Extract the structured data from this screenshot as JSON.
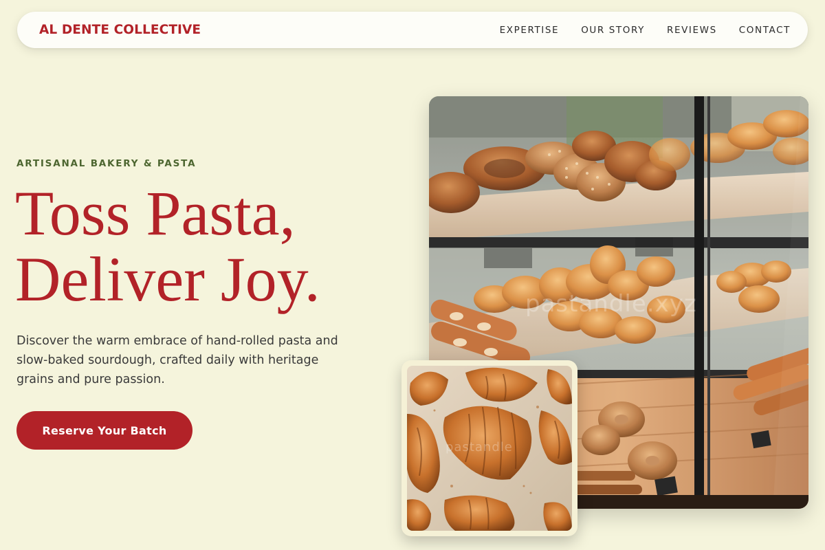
{
  "nav": {
    "brand": "AL DENTE COLLECTIVE",
    "links": [
      "EXPERTISE",
      "OUR STORY",
      "REVIEWS",
      "CONTACT"
    ]
  },
  "hero": {
    "eyebrow": "ARTISANAL BAKERY & PASTA",
    "headline_line1": "Toss Pasta,",
    "headline_line2": "Deliver Joy.",
    "description": "Discover the warm embrace of hand-rolled pasta and slow-baked sourdough, crafted daily with heritage grains and pure passion.",
    "cta_label": "Reserve Your Batch"
  },
  "images": {
    "main_watermark": "pastandle.xyz",
    "inset_watermark": "pastandle"
  },
  "colors": {
    "background": "#f5f4dc",
    "accent": "#b22228",
    "eyebrow": "#4d6630",
    "nav_bg": "#fdfdf8"
  }
}
